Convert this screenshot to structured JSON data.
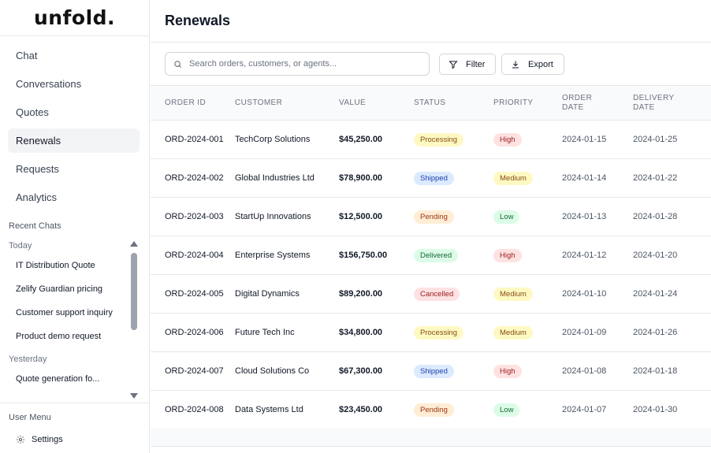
{
  "app": {
    "logo": "unfold."
  },
  "sidebar": {
    "nav": [
      {
        "label": "Chat",
        "active": false
      },
      {
        "label": "Conversations",
        "active": false
      },
      {
        "label": "Quotes",
        "active": false
      },
      {
        "label": "Renewals",
        "active": true
      },
      {
        "label": "Requests",
        "active": false
      },
      {
        "label": "Analytics",
        "active": false
      }
    ],
    "recent_title": "Recent Chats",
    "groups": [
      {
        "label": "Today",
        "items": [
          "IT Distribution Quote",
          "Zelify Guardian pricing",
          "Customer support inquiry",
          "Product demo request"
        ]
      },
      {
        "label": "Yesterday",
        "items": [
          "Quote generation fo..."
        ]
      }
    ],
    "user_menu_label": "User Menu",
    "settings_label": "Settings"
  },
  "main": {
    "title": "Renewals",
    "search": {
      "placeholder": "Search orders, customers, or agents...",
      "value": ""
    },
    "filter_label": "Filter",
    "export_label": "Export"
  },
  "table": {
    "headers": [
      "ORDER ID",
      "CUSTOMER",
      "VALUE",
      "STATUS",
      "PRIORITY",
      "ORDER\nDATE",
      "DELIVERY\nDATE"
    ],
    "rows": [
      {
        "id": "ORD-2024-001",
        "customer": "TechCorp Solutions",
        "value": "$45,250.00",
        "status": "Processing",
        "priority": "High",
        "order_date": "2024-01-15",
        "delivery_date": "2024-01-25"
      },
      {
        "id": "ORD-2024-002",
        "customer": "Global Industries Ltd",
        "value": "$78,900.00",
        "status": "Shipped",
        "priority": "Medium",
        "order_date": "2024-01-14",
        "delivery_date": "2024-01-22"
      },
      {
        "id": "ORD-2024-003",
        "customer": "StartUp Innovations",
        "value": "$12,500.00",
        "status": "Pending",
        "priority": "Low",
        "order_date": "2024-01-13",
        "delivery_date": "2024-01-28"
      },
      {
        "id": "ORD-2024-004",
        "customer": "Enterprise Systems",
        "value": "$156,750.00",
        "status": "Delivered",
        "priority": "High",
        "order_date": "2024-01-12",
        "delivery_date": "2024-01-20"
      },
      {
        "id": "ORD-2024-005",
        "customer": "Digital Dynamics",
        "value": "$89,200.00",
        "status": "Cancelled",
        "priority": "Medium",
        "order_date": "2024-01-10",
        "delivery_date": "2024-01-24"
      },
      {
        "id": "ORD-2024-006",
        "customer": "Future Tech Inc",
        "value": "$34,800.00",
        "status": "Processing",
        "priority": "Medium",
        "order_date": "2024-01-09",
        "delivery_date": "2024-01-26"
      },
      {
        "id": "ORD-2024-007",
        "customer": "Cloud Solutions Co",
        "value": "$67,300.00",
        "status": "Shipped",
        "priority": "High",
        "order_date": "2024-01-08",
        "delivery_date": "2024-01-18"
      },
      {
        "id": "ORD-2024-008",
        "customer": "Data Systems Ltd",
        "value": "$23,450.00",
        "status": "Pending",
        "priority": "Low",
        "order_date": "2024-01-07",
        "delivery_date": "2024-01-30"
      }
    ]
  },
  "colors": {
    "status": {
      "Processing": {
        "bg": "#fef9c3",
        "fg": "#854d0e"
      },
      "Shipped": {
        "bg": "#dbeafe",
        "fg": "#1e40af"
      },
      "Pending": {
        "bg": "#ffedd5",
        "fg": "#9a3412"
      },
      "Delivered": {
        "bg": "#dcfce7",
        "fg": "#166534"
      },
      "Cancelled": {
        "bg": "#fee2e2",
        "fg": "#991b1b"
      }
    },
    "priority": {
      "High": {
        "bg": "#fee2e2",
        "fg": "#991b1b"
      },
      "Medium": {
        "bg": "#fef9c3",
        "fg": "#854d0e"
      },
      "Low": {
        "bg": "#dcfce7",
        "fg": "#166534"
      }
    }
  },
  "icons": {
    "search": "search-icon",
    "filter": "filter-icon",
    "export": "download-icon",
    "settings": "gear-icon"
  }
}
